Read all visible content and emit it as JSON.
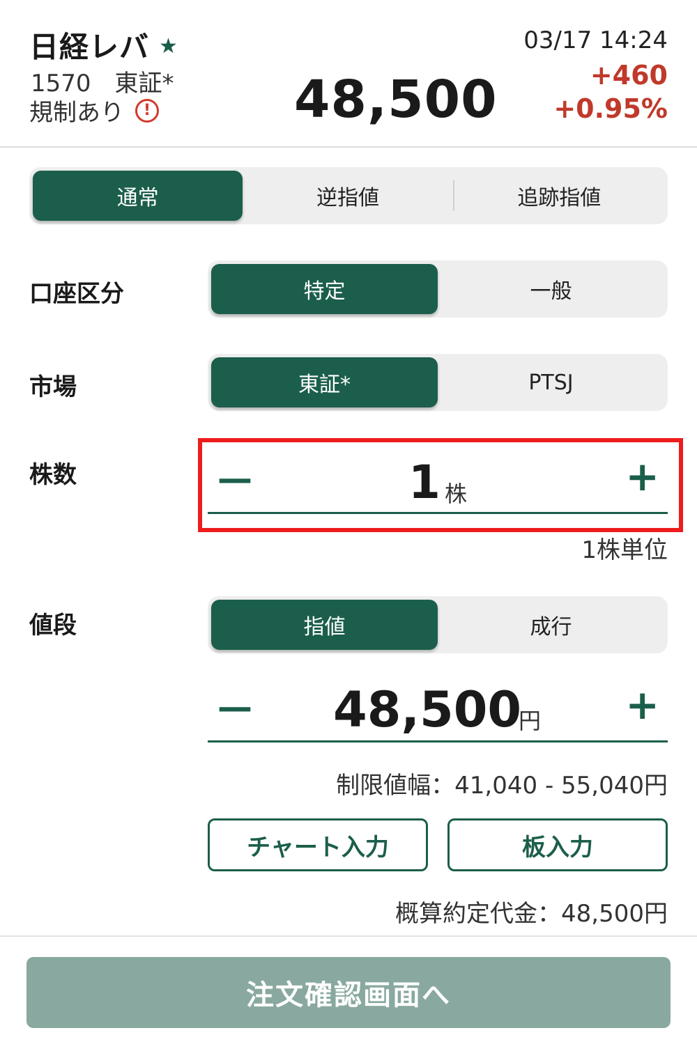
{
  "stock": {
    "name": "日経レバ",
    "code_market": "1570　東証*",
    "regulation": "規制あり",
    "price": "48,500",
    "datetime": "03/17 14:24",
    "change": "+460",
    "change_pct": "+0.95%"
  },
  "order_type_tabs": [
    {
      "label": "通常",
      "active": true
    },
    {
      "label": "逆指値",
      "active": false
    },
    {
      "label": "追跡指値",
      "active": false
    }
  ],
  "account": {
    "label": "口座区分",
    "options": [
      {
        "label": "特定",
        "active": true
      },
      {
        "label": "一般",
        "active": false
      }
    ]
  },
  "market": {
    "label": "市場",
    "options": [
      {
        "label": "東証*",
        "active": true
      },
      {
        "label": "PTSJ",
        "active": false
      }
    ]
  },
  "shares": {
    "label": "株数",
    "value": "1",
    "unit": "株",
    "unit_note": "1株単位"
  },
  "price_section": {
    "label": "値段",
    "options": [
      {
        "label": "指値",
        "active": true
      },
      {
        "label": "成行",
        "active": false
      }
    ],
    "value": "48,500",
    "unit": "円",
    "limit_range": "制限値幅：41,040 - 55,040円",
    "chart_input": "チャート入力",
    "board_input": "板入力",
    "estimate": "概算約定代金：48,500円"
  },
  "submit_label": "注文確認画面へ",
  "colors": {
    "accent": "#1b5e4b",
    "positive": "#c0392b",
    "highlight": "#ee1c1c",
    "submit_disabled": "#89a9a0"
  },
  "icons": {
    "star": "star-icon",
    "warning": "exclamation-circle-icon",
    "minus": "minus-icon",
    "plus": "plus-icon"
  }
}
